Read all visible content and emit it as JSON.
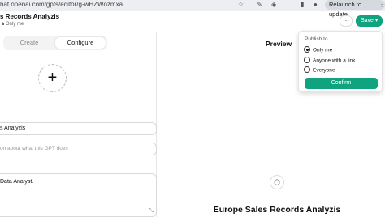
{
  "browser": {
    "url": "hat.openai.com/gpts/editor/g-wHZWozmxa",
    "relaunch_label": "Relaunch to update",
    "icons": [
      "star-icon",
      "pen-icon",
      "shield-icon",
      "extension-icon",
      "ellipsis-icon"
    ]
  },
  "header": {
    "title": "s Records Analyzis",
    "visibility": "Only me",
    "more_label": "···",
    "save_label": "Save ▾"
  },
  "config": {
    "tabs": [
      {
        "label": "Create",
        "active": false
      },
      {
        "label": "Configure",
        "active": true
      }
    ],
    "add_avatar_label": "+",
    "name_value": "s Analyzis",
    "description_placeholder": "on about what this GPT does",
    "instructions_value": "Data Analyst."
  },
  "preview": {
    "label": "Preview",
    "gpt_name": "Europe Sales Records Analyzis"
  },
  "publish_menu": {
    "title": "Publish to",
    "options": [
      {
        "label": "Only me",
        "checked": true
      },
      {
        "label": "Anyone with a link",
        "checked": false
      },
      {
        "label": "Everyone",
        "checked": false
      }
    ],
    "confirm_label": "Confirm"
  },
  "colors": {
    "accent": "#10a37f",
    "browser_bar": "#eceef1"
  }
}
